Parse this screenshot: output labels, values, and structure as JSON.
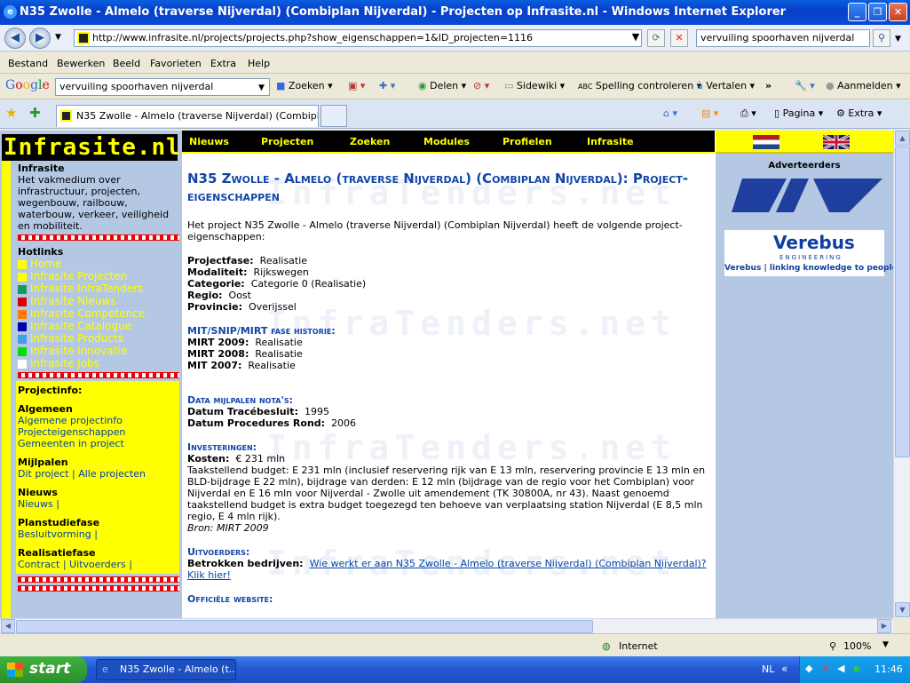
{
  "window": {
    "title": "N35 Zwolle - Almelo (traverse Nijverdal) (Combiplan Nijverdal) - Projecten op Infrasite.nl - Windows Internet Explorer"
  },
  "address_bar": {
    "url": "http://www.infrasite.nl/projects/projects.php?show_eigenschappen=1&ID_projecten=1116",
    "search_value": "vervuiling spoorhaven nijverdal"
  },
  "menu": [
    "Bestand",
    "Bewerken",
    "Beeld",
    "Favorieten",
    "Extra",
    "Help"
  ],
  "google_toolbar": {
    "logo": "Google",
    "search_value": "vervuiling spoorhaven nijverdal",
    "items": [
      "Zoeken",
      "Delen",
      "Sidewiki",
      "Spelling controleren",
      "Vertalen",
      "Aanmelden"
    ]
  },
  "tabs": {
    "active": "N35 Zwolle - Almelo (traverse Nijverdal) (Combiplan Ni...",
    "tools": [
      "Pagina",
      "Extra"
    ]
  },
  "site": {
    "logo": "Infrasite.nl",
    "topnav": [
      "Nieuws",
      "Projecten",
      "Zoeken",
      "Modules",
      "Profielen",
      "Infrasite"
    ],
    "left": {
      "intro_title": "Infrasite",
      "intro_text": "Het vakmedium over infrastructuur, projecten, wegenbouw, railbouw, waterbouw, verkeer, veiligheid en mobiliteit.",
      "hotlinks_title": "Hotlinks",
      "hotlinks": [
        {
          "label": "Home",
          "color": "#ffff00"
        },
        {
          "label": "Infrasite Projecten",
          "color": "#ffff00"
        },
        {
          "label": "Infrasite InfraTenders",
          "color": "#1a9a5a"
        },
        {
          "label": "Infrasite Nieuws",
          "color": "#e00000"
        },
        {
          "label": "Infrasite Competence",
          "color": "#ff7a00"
        },
        {
          "label": "Infrasite Catalogue",
          "color": "#0000b0"
        },
        {
          "label": "Infrasite Products",
          "color": "#3fa0e0"
        },
        {
          "label": "Infrasite Innovatie",
          "color": "#00e000"
        },
        {
          "label": "Infrasite Jobs",
          "color": "#ffffff"
        }
      ],
      "projectinfo_title": "Projectinfo:",
      "groups": [
        {
          "title": "Algemeen",
          "links": "Algemene projectinfo\nProjecteigenschappen\nGemeenten in project"
        },
        {
          "title": "Mijlpalen",
          "links": "Dit project | Alle projecten"
        },
        {
          "title": "Nieuws",
          "links": "Nieuws |"
        },
        {
          "title": "Planstudiefase",
          "links": "Besluitvorming |"
        },
        {
          "title": "Realisatiefase",
          "links": "Contract | Uitvoerders |"
        }
      ]
    },
    "right": {
      "advertisers_label": "Adverteerders",
      "ad1_text": "DHV",
      "ad2_name": "Verebus",
      "ad2_sub": "ENGINEERING",
      "ad2_slogan": "Verebus | linking knowledge to people's use"
    },
    "watermark": "InfraTenders.net",
    "main": {
      "title": "N35 Zwolle - Almelo (traverse Nijverdal) (Combiplan Nijverdal): Project-eigenschappen",
      "intro": "Het project N35 Zwolle - Almelo (traverse Nijverdal) (Combiplan Nijverdal) heeft de volgende project-eigenschappen:",
      "properties": [
        {
          "k": "Projectfase:",
          "v": "Realisatie"
        },
        {
          "k": "Modaliteit:",
          "v": "Rijkswegen"
        },
        {
          "k": "Categorie:",
          "v": "Categorie 0 (Realisatie)"
        },
        {
          "k": "Regio:",
          "v": "Oost"
        },
        {
          "k": "Provincie:",
          "v": "Overijssel"
        }
      ],
      "mit_title": "MIT/SNIP/MIRT fase historie:",
      "mit": [
        {
          "k": "MIRT 2009:",
          "v": "Realisatie"
        },
        {
          "k": "MIRT 2008:",
          "v": "Realisatie"
        },
        {
          "k": "MIT 2007:",
          "v": "Realisatie"
        }
      ],
      "milestones_title": "Data mijlpalen nota's:",
      "milestones": [
        {
          "k": "Datum Tracébesluit:",
          "v": "1995"
        },
        {
          "k": "Datum Procedures Rond:",
          "v": "2006"
        }
      ],
      "invest_title": "Investeringen:",
      "cost_k": "Kosten:",
      "cost_v": "€ 231 mln",
      "invest_text": "Taakstellend budget: E 231 mln (inclusief reservering rijk van E 13 mln, reservering provincie E 13 mln en BLD-bijdrage E 22 mln), bijdrage van derden: E 12 mln (bijdrage van de regio voor het Combiplan) voor Nijverdal en E 16 mln voor Nijverdal - Zwolle uit amendement (TK 30800A, nr 43). Naast genoemd taakstellend budget is extra budget toegezegd ten behoeve van verplaatsing station Nijverdal (E 8,5 mln regio, E 4 mln rijk).",
      "source": "Bron: MIRT 2009",
      "exec_title": "Uitvoerders:",
      "exec_k": "Betrokken bedrijven:",
      "exec_link": "Wie werkt er aan N35 Zwolle - Almelo (traverse Nijverdal) (Combiplan Nijverdal)? Klik hier!",
      "official_title": "Officiële website:"
    }
  },
  "status": {
    "zone": "Internet",
    "zoom": "100%"
  },
  "taskbar": {
    "start": "start",
    "item": "N35 Zwolle - Almelo (t...",
    "lang": "NL",
    "time": "11:46"
  }
}
